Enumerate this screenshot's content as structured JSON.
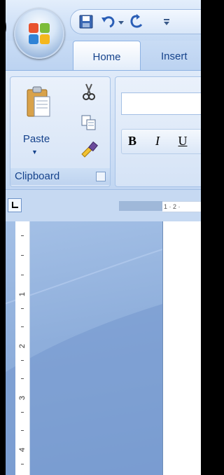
{
  "title_bar": {
    "partial_text": ")"
  },
  "tabs": [
    {
      "label": "Home"
    },
    {
      "label": "Insert"
    }
  ],
  "ribbon": {
    "clipboard": {
      "paste_label": "Paste",
      "group_label": "Clipboard"
    },
    "font": {
      "bold_label": "B",
      "italic_label": "I",
      "underline_label": "U"
    }
  },
  "ruler": {
    "horizontal_text": "1 · 2 ·",
    "vertical_numbers": [
      "1",
      "2",
      "3",
      "4"
    ]
  },
  "colors": {
    "tab_text": "#15428b",
    "ribbon_bg": "#cfdff5",
    "workspace_bg": "#8eaedb"
  }
}
